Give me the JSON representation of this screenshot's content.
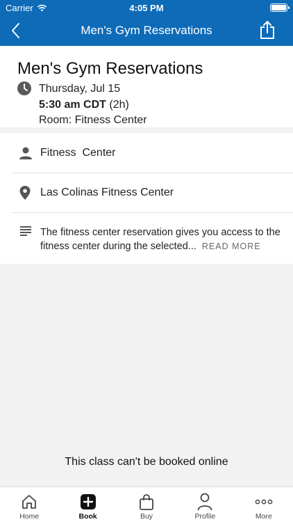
{
  "status_bar": {
    "carrier": "Carrier",
    "time": "4:05 PM"
  },
  "nav": {
    "title": "Men's Gym Reservations",
    "back_icon": "chevron-left-icon",
    "share_icon": "share-icon"
  },
  "summary": {
    "title": "Men's Gym Reservations",
    "date": "Thursday, Jul 15",
    "time": "5:30 am CDT",
    "duration": "(2h)",
    "room": "Room: Fitness Center"
  },
  "details": {
    "instructor": "Fitness  Center",
    "location": "Las Colinas Fitness Center",
    "description": "The fitness center reservation gives you access to the fitness center during the selected...",
    "read_more": "READ MORE"
  },
  "notice": "This class can't be booked online",
  "tabs": [
    {
      "label": "Home",
      "icon": "home-icon"
    },
    {
      "label": "Book",
      "icon": "plus-square-icon"
    },
    {
      "label": "Buy",
      "icon": "shopping-bag-icon"
    },
    {
      "label": "Profile",
      "icon": "person-icon"
    },
    {
      "label": "More",
      "icon": "ellipsis-icon"
    }
  ],
  "colors": {
    "header": "#0e6bb8",
    "background": "#f2f2f2"
  }
}
